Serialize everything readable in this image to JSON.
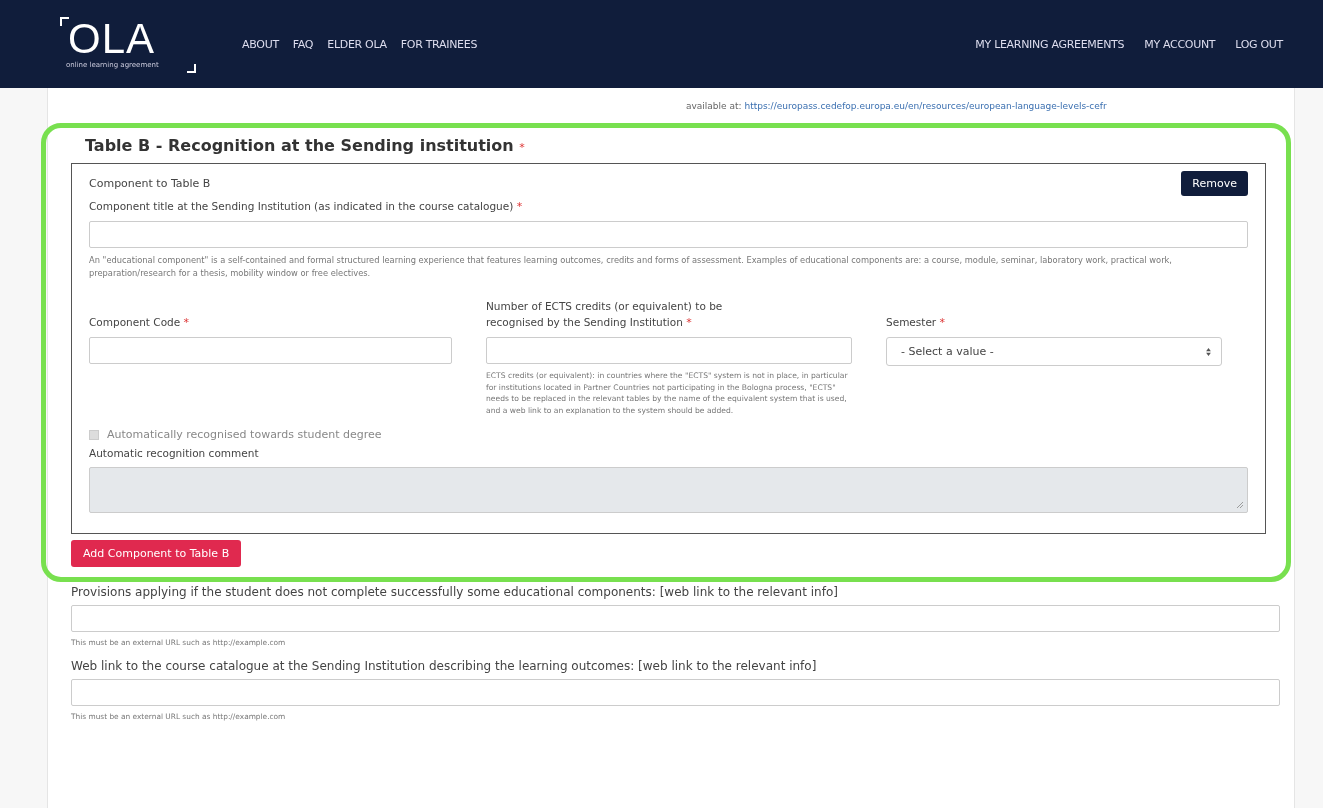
{
  "header": {
    "logo": "OLA",
    "logo_tagline": "online learning agreement",
    "nav_left": [
      "ABOUT",
      "FAQ",
      "ELDER OLA",
      "FOR TRAINEES"
    ],
    "nav_right": [
      "MY LEARNING AGREEMENTS",
      "MY ACCOUNT",
      "LOG OUT"
    ]
  },
  "top_note": {
    "text": "available at:",
    "link": "https://europass.cedefop.europa.eu/en/resources/european-language-levels-cefr"
  },
  "table_b": {
    "title": "Table B - Recognition at the Sending institution",
    "required_mark": "*",
    "component": {
      "heading": "Component to Table B",
      "remove_button": "Remove",
      "title_field": {
        "label": "Component title at the Sending Institution (as indicated in the course catalogue)",
        "required_mark": "*",
        "hint": "An \"educational component\" is a self-contained and formal structured learning experience that features learning outcomes, credits and forms of assessment. Examples of educational components are: a course, module, seminar, laboratory work, practical work, preparation/research for a thesis, mobility window or free electives."
      },
      "code_field": {
        "label": "Component Code",
        "required_mark": "*"
      },
      "credits_field": {
        "label": "Number of ECTS credits (or equivalent) to be recognised by the Sending Institution",
        "required_mark": "*",
        "hint": "ECTS credits (or equivalent): in countries where the \"ECTS\" system is not in place, in particular for institutions located in Partner Countries not participating in the Bologna process, \"ECTS\" needs to be replaced in the relevant tables by the name of the equivalent system that is used, and a web link to an explanation to the system should be added."
      },
      "semester_field": {
        "label": "Semester",
        "required_mark": "*",
        "value": "- Select a value -"
      },
      "auto_checkbox": {
        "label": "Automatically recognised towards student degree",
        "checked": false,
        "disabled": true
      },
      "comment_field": {
        "label": "Automatic recognition comment",
        "disabled": true
      }
    },
    "add_button": "Add Component to Table B"
  },
  "link_fields": [
    {
      "label": "Provisions applying if the student does not complete successfully some educational components: [web link to the relevant info]",
      "hint": "This must be an external URL such as http://example.com"
    },
    {
      "label": "Web link to the course catalogue at the Sending Institution describing the learning outcomes: [web link to the relevant info]",
      "hint": "This must be an external URL such as http://example.com"
    }
  ]
}
